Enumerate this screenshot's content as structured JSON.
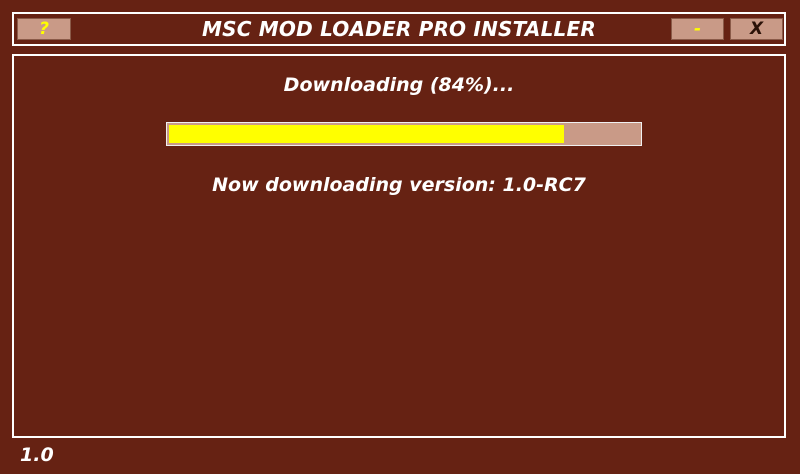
{
  "window": {
    "title": "MSC MOD LOADER PRO INSTALLER",
    "help_label": "?",
    "minimize_label": "-",
    "close_label": "X"
  },
  "download": {
    "status_text": "Downloading (84%)...",
    "progress_percent": 84,
    "version_text": "Now downloading version: 1.0-RC7"
  },
  "footer": {
    "app_version": "1.0"
  },
  "colors": {
    "background": "#662213",
    "button": "#c99a87",
    "accent": "#ffff00",
    "text": "#ffffff"
  }
}
